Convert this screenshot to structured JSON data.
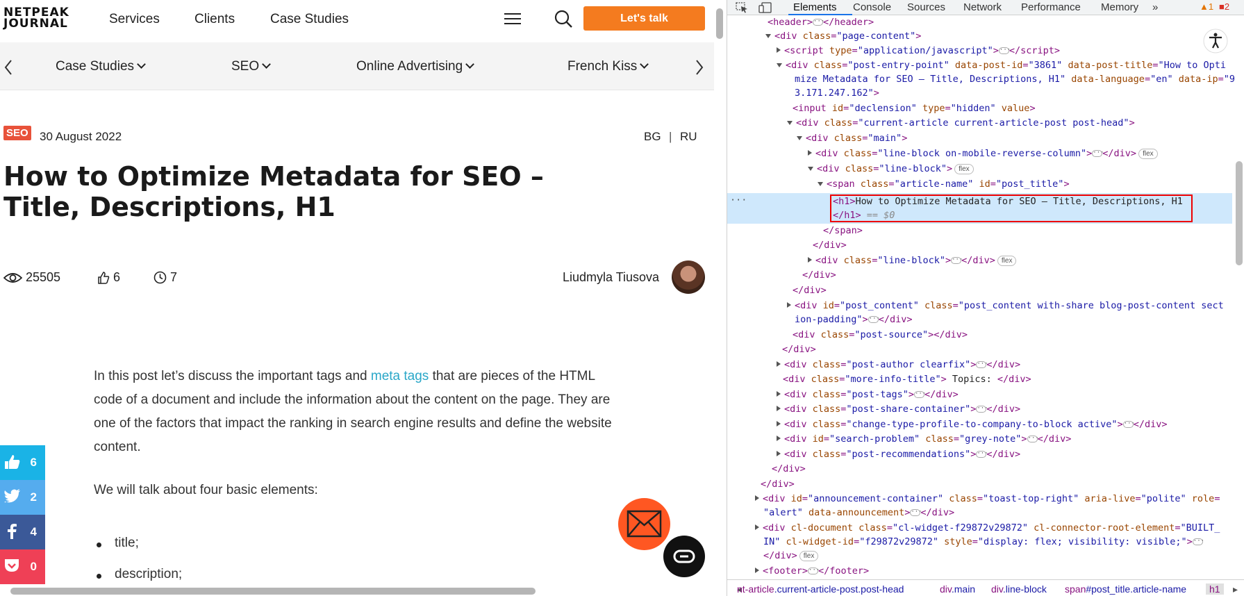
{
  "site": {
    "logo_line1": "NETPEAK",
    "logo_line2": "JOURNAL",
    "nav": [
      "Services",
      "Clients",
      "Case Studies"
    ],
    "cta_label": "Let's talk",
    "categories": [
      "Case Studies",
      "SEO",
      "Online Advertising",
      "French Kiss"
    ]
  },
  "article": {
    "tag": "SEO",
    "date": "30 August 2022",
    "languages": [
      "BG",
      "RU"
    ],
    "language_separator": "|",
    "title": "How to Optimize Metadata for SEO – Title, Descriptions, H1",
    "views": "25505",
    "likes": "6",
    "read_minutes": "7",
    "author": "Liudmyla Tiusova",
    "para1_a": "In this post let’s discuss the important tags and ",
    "para1_link": "meta tags",
    "para1_b": " that are pieces of the HTML code of a document and include the information about the content on the page. They are one of the factors that impact the ranking in search engine results and define the website content.",
    "para2": "We will talk about four basic elements:",
    "list": [
      "title;",
      "description;"
    ]
  },
  "share": {
    "like_count": "6",
    "twitter_count": "2",
    "facebook_count": "4",
    "pocket_count": "0",
    "colors": {
      "like": "#1ab3e6",
      "twitter": "#55acee",
      "facebook": "#3b5998",
      "pocket": "#ef4056"
    }
  },
  "devtools": {
    "tabs": [
      "Elements",
      "Console",
      "Sources",
      "Network",
      "Performance",
      "Memory"
    ],
    "more_tabs": "»",
    "warnings": "1",
    "errors": "2",
    "breadcrumbs": [
      {
        "tag": "nt-article",
        "cls": ".current-article-post.post-head"
      },
      {
        "tag": "div",
        "cls": ".main"
      },
      {
        "tag": "div",
        "cls": ".line-block"
      },
      {
        "tag": "span",
        "cls": "#post_title.article-name"
      },
      {
        "tag": "h1",
        "cls": ""
      }
    ],
    "selected_marker": "== $0"
  }
}
